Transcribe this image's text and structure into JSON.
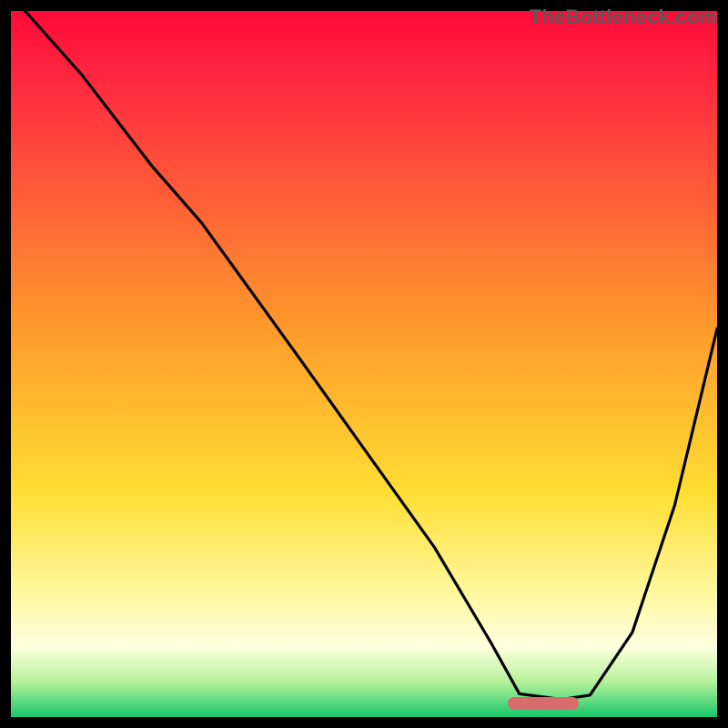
{
  "watermark": "TheBottleneck.com",
  "chart_data": {
    "type": "line",
    "title": "",
    "xlabel": "",
    "ylabel": "",
    "xlim": [
      0,
      100
    ],
    "ylim": [
      0,
      100
    ],
    "series": [
      {
        "name": "curve",
        "x": [
          2,
          10,
          20,
          27,
          40,
          50,
          60,
          68,
          72,
          78,
          82,
          88,
          94,
          100
        ],
        "values": [
          100,
          91,
          78,
          70,
          52,
          38,
          24,
          10.5,
          3.3,
          2.5,
          3.1,
          12,
          30,
          55
        ]
      }
    ],
    "marker": {
      "x_start": 70,
      "x_end": 80,
      "y": 2.5
    },
    "gradient_stops": [
      {
        "pct": 0,
        "color": "#ff0a3a"
      },
      {
        "pct": 12,
        "color": "#ff2f3f"
      },
      {
        "pct": 45,
        "color": "#ff9a2b"
      },
      {
        "pct": 68,
        "color": "#ffde32"
      },
      {
        "pct": 82,
        "color": "#fff79a"
      },
      {
        "pct": 90,
        "color": "#ffffe0"
      },
      {
        "pct": 95,
        "color": "#b6f29a"
      },
      {
        "pct": 100,
        "color": "#18c76a"
      }
    ]
  }
}
